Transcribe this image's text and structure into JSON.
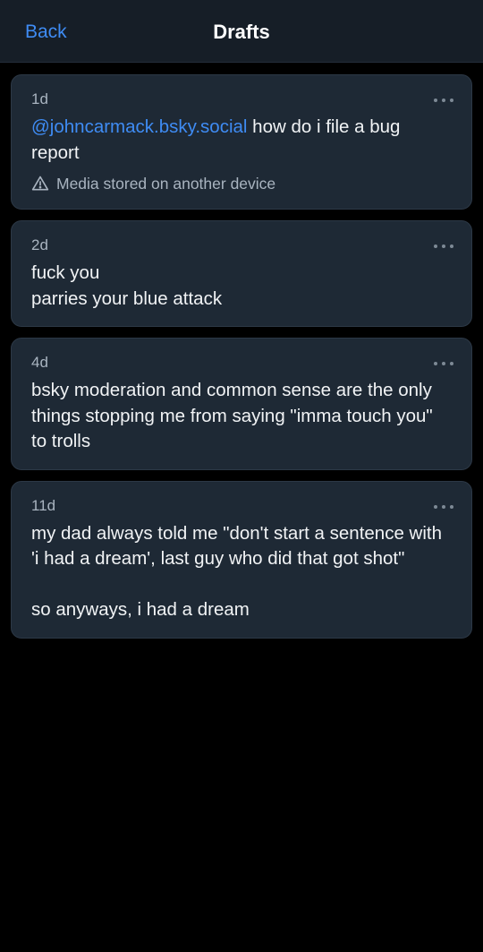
{
  "header": {
    "back_label": "Back",
    "title": "Drafts"
  },
  "drafts": [
    {
      "age": "1d",
      "mention": "@johncarmack.bsky.social",
      "text": " how do i file a bug report",
      "media_note": "Media stored on another device",
      "icon": "warning-triangle-icon"
    },
    {
      "age": "2d",
      "text": "fuck you\nparries your blue attack"
    },
    {
      "age": "4d",
      "text": "bsky moderation and common sense are the only things stopping me from saying \"imma touch you\" to trolls"
    },
    {
      "age": "11d",
      "text": "my dad always told me \"don't start a sentence with 'i had a dream', last guy who did that got shot\"\n\nso anyways, i had a dream"
    }
  ],
  "colors": {
    "accent": "#3f8cf4",
    "card_bg": "#1e2935",
    "header_bg": "#161e27",
    "background": "#000000"
  }
}
